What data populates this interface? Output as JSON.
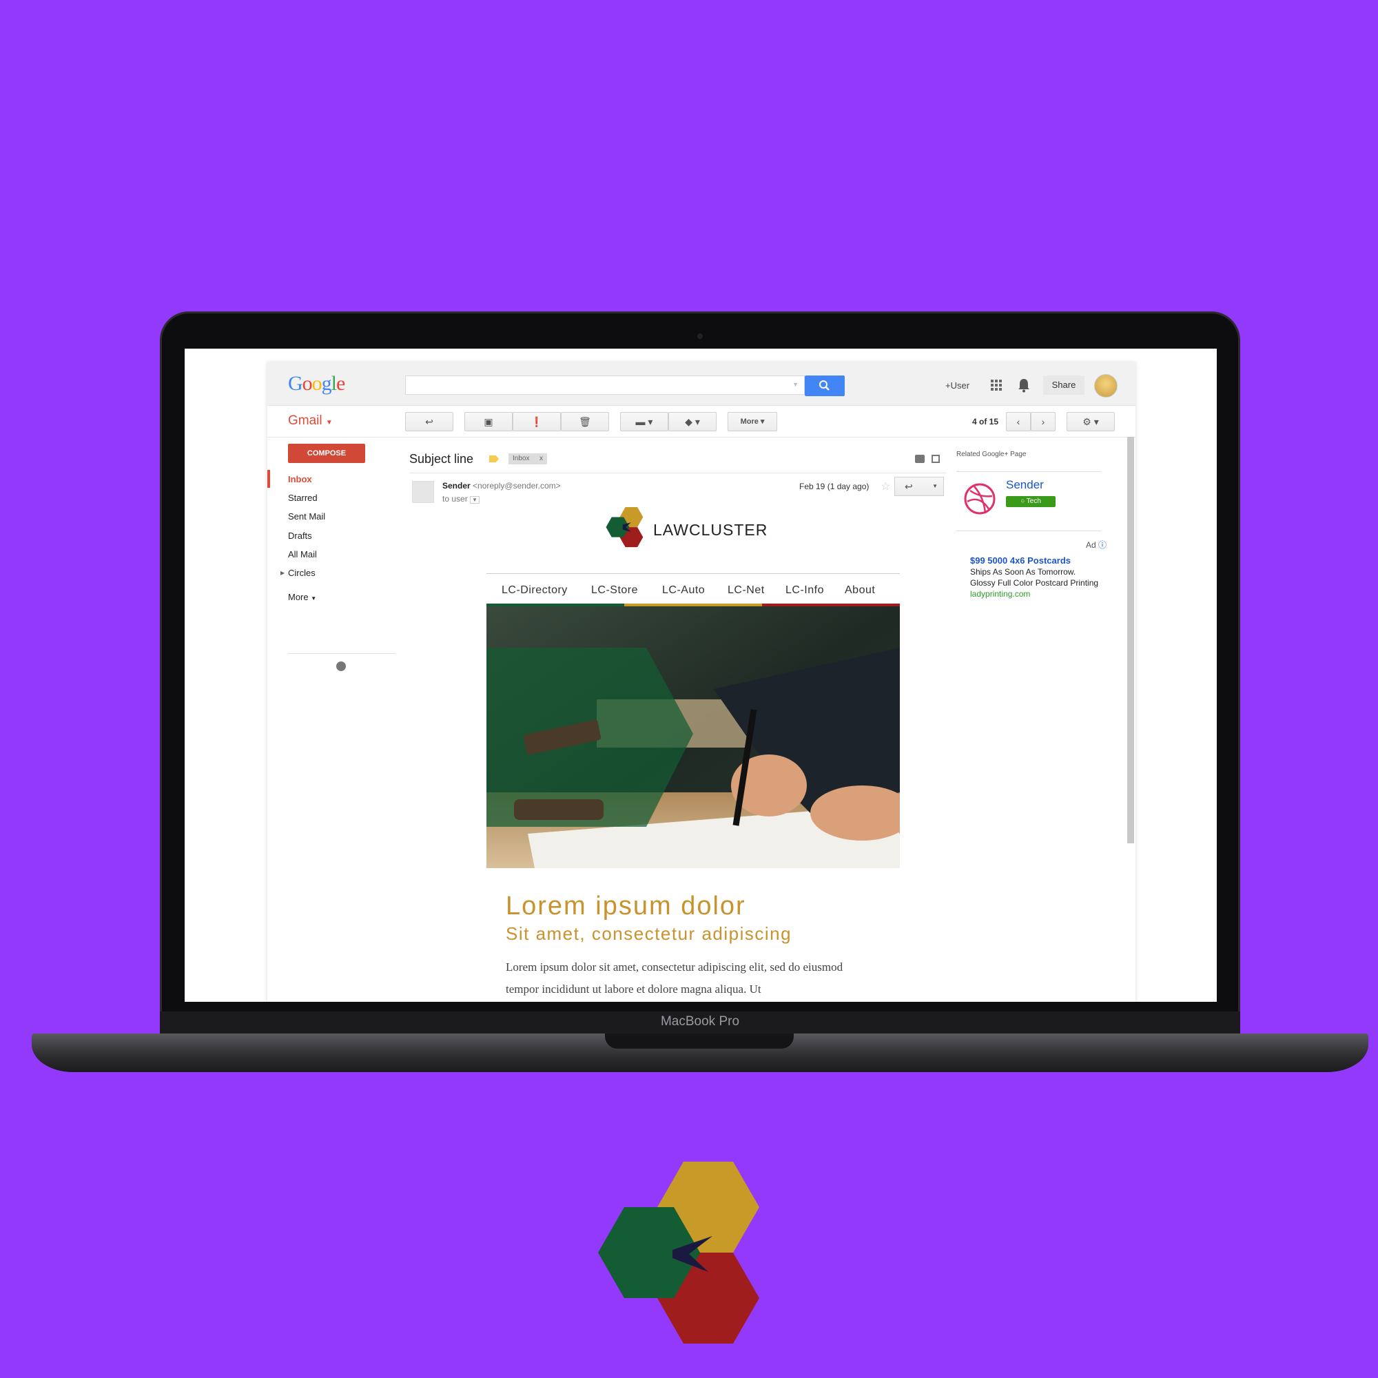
{
  "laptop": {
    "brand_label": "MacBook Pro"
  },
  "header": {
    "logo_letters": [
      "G",
      "o",
      "o",
      "g",
      "l",
      "e"
    ],
    "logo_colors": [
      "#4285f4",
      "#ea4335",
      "#fbbc05",
      "#4285f4",
      "#34a853",
      "#ea4335"
    ],
    "user_link": "+User",
    "share_label": "Share"
  },
  "toolbar": {
    "app_label": "Gmail",
    "more_label": "More",
    "pager": "4 of 15"
  },
  "sidebar": {
    "compose_label": "COMPOSE",
    "items": [
      {
        "label": "Inbox"
      },
      {
        "label": "Starred"
      },
      {
        "label": "Sent Mail"
      },
      {
        "label": "Drafts"
      },
      {
        "label": "All Mail"
      },
      {
        "label": "Circles"
      },
      {
        "label": "More"
      }
    ]
  },
  "message": {
    "subject": "Subject line",
    "label_badge": "Inbox",
    "sender_name": "Sender",
    "sender_email": "<noreply@sender.com>",
    "recipient": "to user",
    "date": "Feb 19 (1 day ago)"
  },
  "newsletter": {
    "brand": "LAWCLUSTER",
    "nav": [
      "LC-Directory",
      "LC-Store",
      "LC-Auto",
      "LC-Net",
      "LC-Info",
      "About"
    ],
    "title": "Lorem ipsum dolor",
    "subtitle": "Sit amet, consectetur adipiscing",
    "body": "Lorem ipsum dolor sit amet, consectetur adipiscing elit, sed do eiusmod tempor incididunt ut labore et dolore magna aliqua. Ut",
    "colors": {
      "green": "#145c33",
      "gold": "#c89a28",
      "red": "#a01d1d"
    }
  },
  "right_panel": {
    "related_title": "Related Google+ Page",
    "page_name": "Sender",
    "page_badge": "Tech",
    "ad_label": "Ad",
    "ad_title": "$99 5000 4x6 Postcards",
    "ad_line1": "Ships As Soon As Tomorrow.",
    "ad_line2": "Glossy Full Color Postcard Printing",
    "ad_url": "ladyprinting.com"
  },
  "background_color": "#9339fb"
}
